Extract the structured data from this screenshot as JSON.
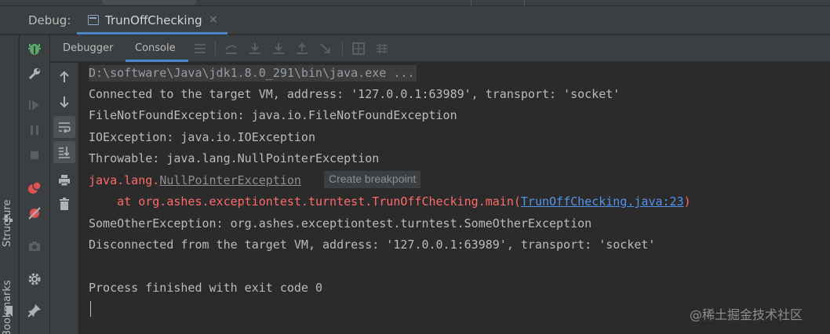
{
  "debug_window": {
    "title": "Debug:",
    "run_tab": {
      "label": "TrunOffChecking",
      "close": "×"
    }
  },
  "side_tools": {
    "structure_label": "Structure",
    "bookmarks_label": "Bookmarks"
  },
  "tabs": [
    {
      "label": "Debugger",
      "active": false
    },
    {
      "label": "Console",
      "active": true
    }
  ],
  "console": {
    "lines": [
      "D:\\software\\Java\\jdk1.8.0_291\\bin\\java.exe ...",
      "Connected to the target VM, address: '127.0.0.1:63989', transport: 'socket'",
      "FileNotFoundException: java.io.FileNotFoundException",
      "IOException: java.io.IOException",
      "Throwable: java.lang.NullPointerException",
      "SomeOtherException: org.ashes.exceptiontest.turntest.SomeOtherException",
      "Disconnected from the target VM, address: '127.0.0.1:63989', transport: 'socket'",
      "Process finished with exit code 0"
    ],
    "exception": {
      "prefix": "java.lang.",
      "class_name": "NullPointerException",
      "tooltip": "Create breakpoint",
      "stack_prefix": "    at org.ashes.exceptiontest.turntest.TrunOffChecking.main(",
      "stack_link": "TrunOffChecking.java:23",
      "stack_suffix": ")"
    }
  },
  "watermark": "@稀土掘金技术社区",
  "colors": {
    "panel": "#3c3f41",
    "console_bg": "#2b2b2b",
    "text": "#bbbbbb",
    "error_text": "#ff6b68",
    "link": "#5394ec",
    "accent": "#4a88c7"
  }
}
